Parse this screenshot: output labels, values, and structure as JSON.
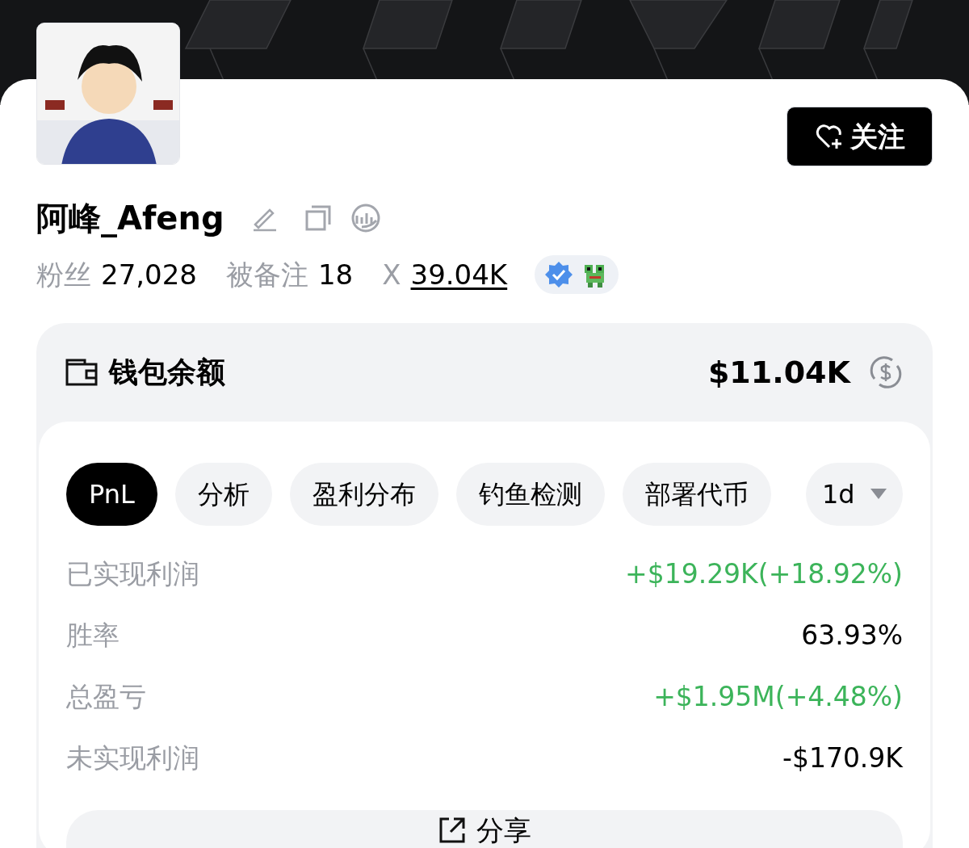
{
  "profile": {
    "follow_button": "关注",
    "name": "阿峰_Afeng",
    "stats": [
      {
        "label": "粉丝",
        "value": "27,028",
        "underline": false
      },
      {
        "label": "被备注",
        "value": "18",
        "underline": false
      },
      {
        "label": "X",
        "value": "39.04K",
        "underline": true
      }
    ]
  },
  "wallet": {
    "title": "钱包余额",
    "balance": "$11.04K",
    "tabs": [
      {
        "label": "PnL",
        "selected": true
      },
      {
        "label": "分析",
        "selected": false
      },
      {
        "label": "盈利分布",
        "selected": false
      },
      {
        "label": "钓鱼检测",
        "selected": false
      },
      {
        "label": "部署代币",
        "selected": false
      }
    ],
    "period": "1d",
    "rows": [
      {
        "label": "已实现利润",
        "value": "+$19.29K(+18.92%)",
        "positive": true
      },
      {
        "label": "胜率",
        "value": "63.93%",
        "positive": false
      },
      {
        "label": "总盈亏",
        "value": "+$1.95M(+4.48%)",
        "positive": true
      },
      {
        "label": "未实现利润",
        "value": "-$170.9K",
        "positive": false
      }
    ],
    "share_button": "分享"
  }
}
